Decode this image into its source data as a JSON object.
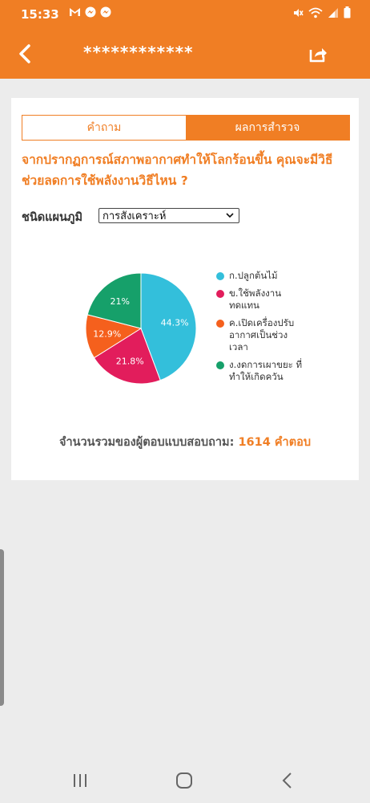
{
  "status_bar": {
    "time": "15:33",
    "icons": [
      "gmail-icon",
      "messenger-icon",
      "messenger-icon"
    ],
    "right_icons": [
      "mute-icon",
      "wifi-icon",
      "signal-icon",
      "battery-icon"
    ]
  },
  "app_bar": {
    "title": "************"
  },
  "tabs": [
    {
      "label": "คำถาม",
      "active": false
    },
    {
      "label": "ผลการสำรวจ",
      "active": true
    }
  ],
  "question": "จากปรากฏการณ์สภาพอากาศทำให้โลกร้อนขึ้น คุณจะมีวิธีช่วยลดการใช้พลังงานวิธีไหน ?",
  "chart_type": {
    "label": "ชนิดแผนภูมิ",
    "selected": "การสังเคราะห์"
  },
  "chart_data": {
    "type": "pie",
    "categories": [
      "ก.ปลูกต้นไม้",
      "ข.ใช้พลังงานทดแทน",
      "ค.เปิดเครื่องปรับอากาศเป็นช่วงเวลา",
      "ง.งดการเผาขยะ ที่ทำให้เกิดควัน"
    ],
    "values": [
      44.3,
      21.8,
      12.9,
      21.0
    ],
    "labels": [
      "44.3%",
      "21.8%",
      "12.9%",
      "21%"
    ],
    "colors": [
      "#33bfdb",
      "#e21d5c",
      "#f5601d",
      "#16a06a"
    ],
    "legend": [
      {
        "label": "ก.ปลูกต้นไม้",
        "color": "#33bfdb"
      },
      {
        "label": "ข.ใช้พลังงานทดแทน",
        "color": "#e21d5c"
      },
      {
        "label": "ค.เปิดเครื่องปรับอากาศเป็นช่วงเวลา",
        "color": "#f5601d"
      },
      {
        "label": "ง.งดการเผาขยะ ที่ทำให้เกิดควัน",
        "color": "#16a06a"
      }
    ]
  },
  "total": {
    "label": "จำนวนรวมของผู้ตอบแบบสอบถาม:",
    "count": "1614 คำตอบ"
  }
}
